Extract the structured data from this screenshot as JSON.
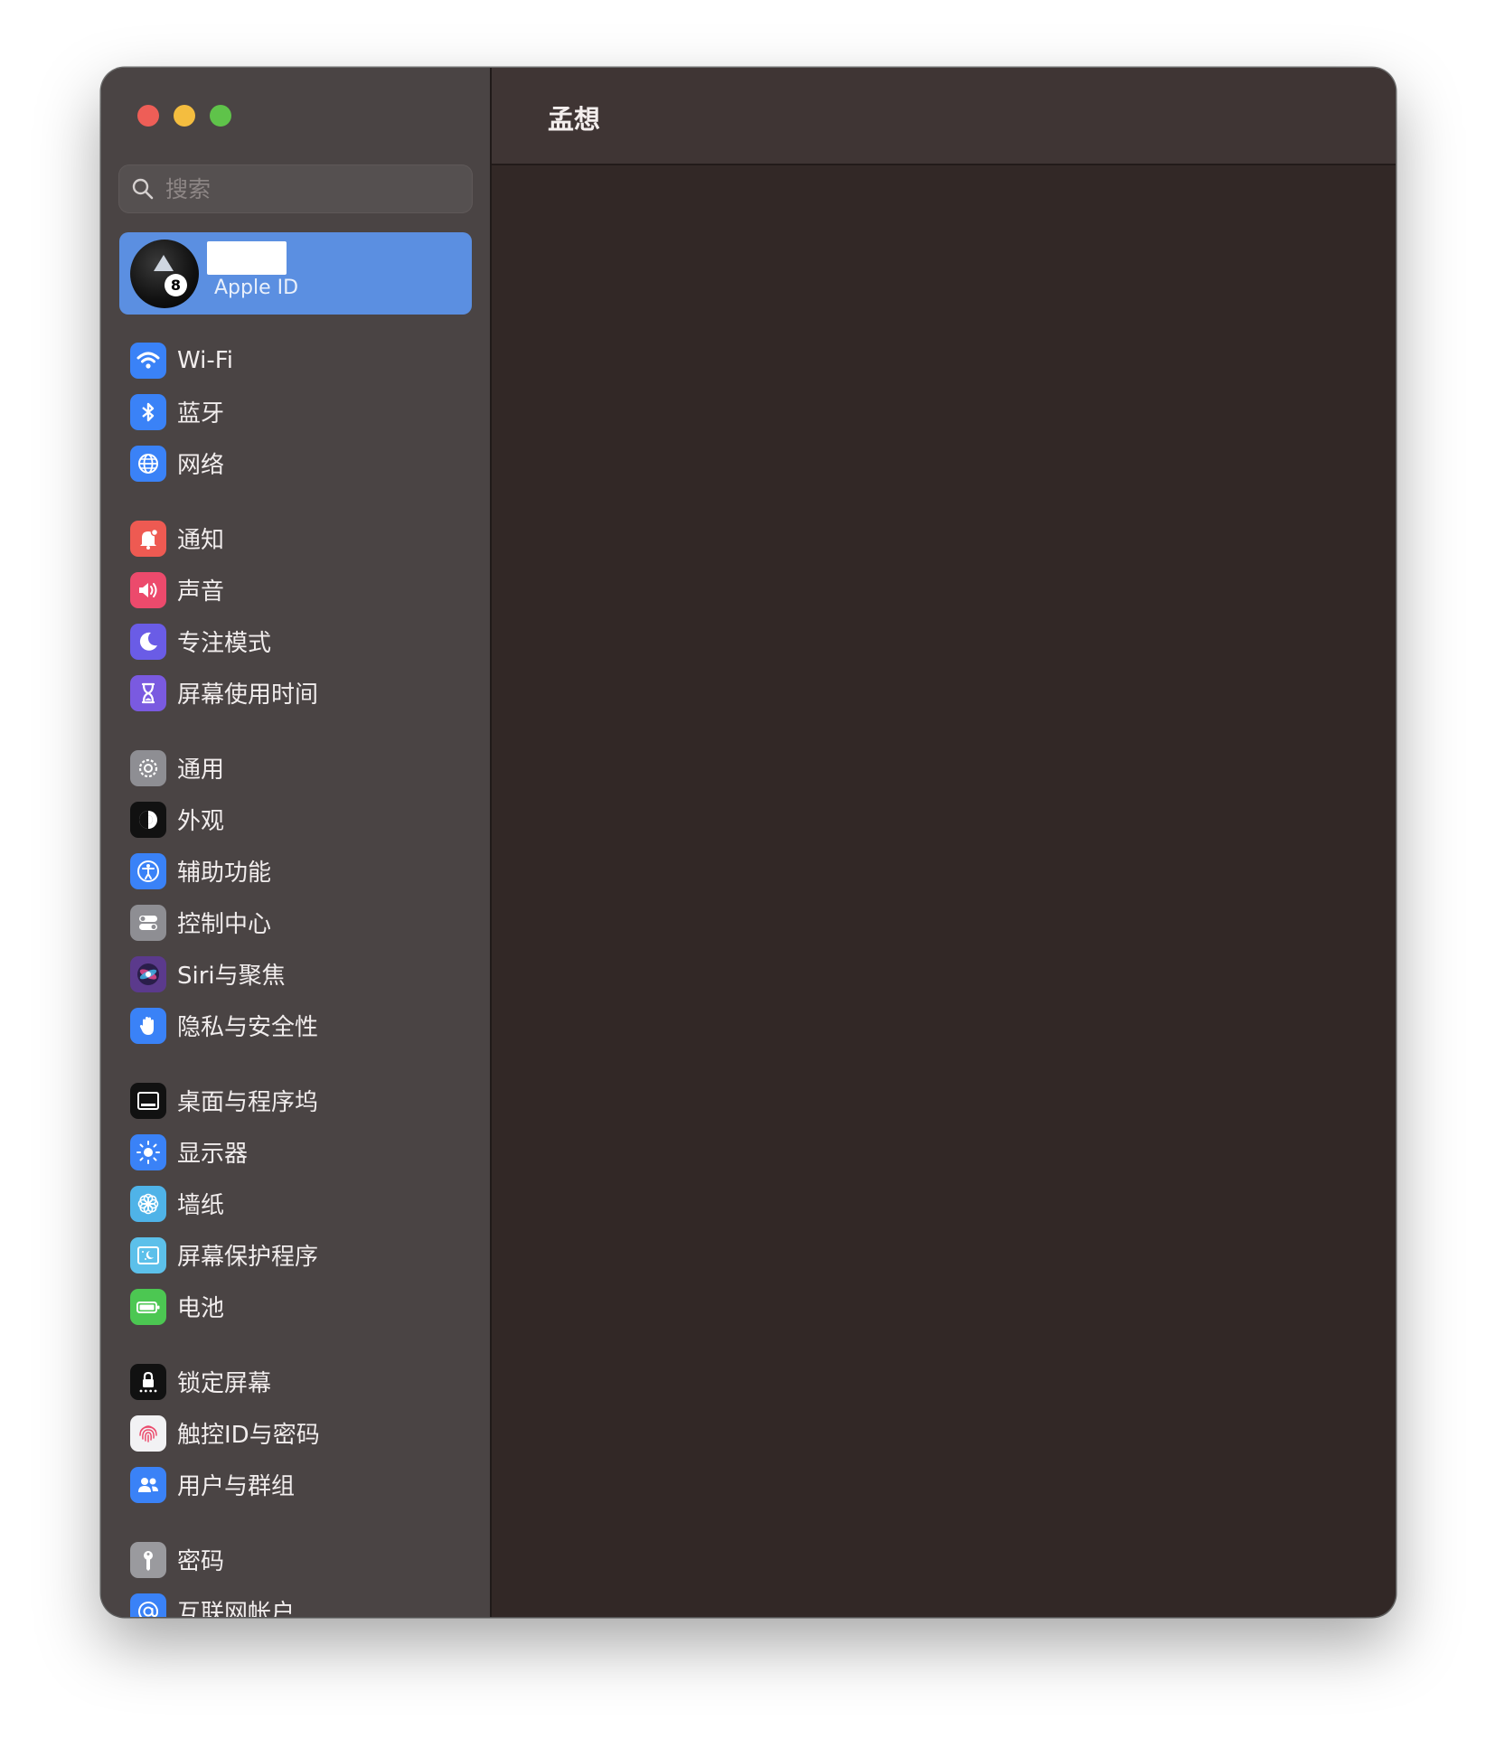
{
  "window": {
    "title": "孟想"
  },
  "search": {
    "placeholder": "搜索"
  },
  "account": {
    "label": "Apple ID"
  },
  "sidebar": {
    "groups": [
      {
        "items": [
          {
            "label": "Wi-Fi",
            "icon": "wifi-icon",
            "color": "#3a82f7"
          },
          {
            "label": "蓝牙",
            "icon": "bluetooth-icon",
            "color": "#3a82f7"
          },
          {
            "label": "网络",
            "icon": "globe-icon",
            "color": "#3a82f7"
          }
        ]
      },
      {
        "items": [
          {
            "label": "通知",
            "icon": "bell-icon",
            "color": "#ee5a52"
          },
          {
            "label": "声音",
            "icon": "speaker-icon",
            "color": "#ec4a6c"
          },
          {
            "label": "专注模式",
            "icon": "moon-icon",
            "color": "#6a5ce6"
          },
          {
            "label": "屏幕使用时间",
            "icon": "hourglass-icon",
            "color": "#7a5ae0"
          }
        ]
      },
      {
        "items": [
          {
            "label": "通用",
            "icon": "gear-icon",
            "color": "#8e8e93"
          },
          {
            "label": "外观",
            "icon": "appearance-icon",
            "color": "#111111"
          },
          {
            "label": "辅助功能",
            "icon": "accessibility-icon",
            "color": "#3a82f7"
          },
          {
            "label": "控制中心",
            "icon": "toggles-icon",
            "color": "#8e8e93"
          },
          {
            "label": "Siri与聚焦",
            "icon": "siri-icon",
            "color": "#5b3a8c"
          },
          {
            "label": "隐私与安全性",
            "icon": "hand-icon",
            "color": "#3a82f7"
          }
        ]
      },
      {
        "items": [
          {
            "label": "桌面与程序坞",
            "icon": "dock-icon",
            "color": "#111111"
          },
          {
            "label": "显示器",
            "icon": "sun-icon",
            "color": "#3a82f7"
          },
          {
            "label": "墙纸",
            "icon": "flower-icon",
            "color": "#4fb3e8"
          },
          {
            "label": "屏幕保护程序",
            "icon": "screensaver-icon",
            "color": "#5cc0ea"
          },
          {
            "label": "电池",
            "icon": "battery-icon",
            "color": "#4cc752"
          }
        ]
      },
      {
        "items": [
          {
            "label": "锁定屏幕",
            "icon": "lock-icon",
            "color": "#111111"
          },
          {
            "label": "触控ID与密码",
            "icon": "fingerprint-icon",
            "color": "#f2f2f4"
          },
          {
            "label": "用户与群组",
            "icon": "users-icon",
            "color": "#3a82f7"
          }
        ]
      },
      {
        "items": [
          {
            "label": "密码",
            "icon": "key-icon",
            "color": "#9a9a9e"
          },
          {
            "label": "互联网帐户",
            "icon": "at-icon",
            "color": "#3a82f7"
          }
        ]
      }
    ]
  }
}
